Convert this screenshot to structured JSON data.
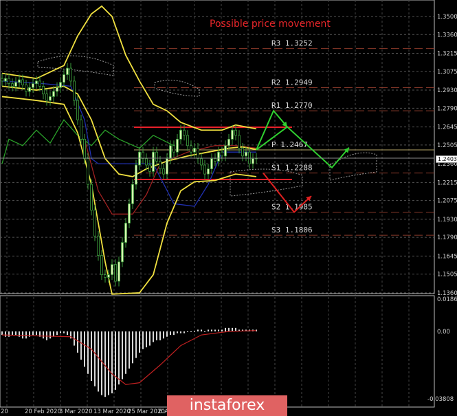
{
  "chart_data": {
    "type": "candlestick",
    "title": "Possible price movement",
    "symbol_last_price": "1.2403",
    "ylim": [
      1.136,
      1.365
    ],
    "y_ticks": [
      "1.3500",
      "1.3360",
      "1.3215",
      "1.3075",
      "1.2930",
      "1.2790",
      "1.2645",
      "1.2505",
      "1.2360",
      "1.2215",
      "1.2075",
      "1.1930",
      "1.1790",
      "1.1645",
      "1.1505",
      "1.1360"
    ],
    "y_tick_values": [
      1.35,
      1.336,
      1.3215,
      1.3075,
      1.293,
      1.279,
      1.2645,
      1.2505,
      1.236,
      1.2215,
      1.2075,
      1.193,
      1.179,
      1.1645,
      1.1505,
      1.136
    ],
    "x_ticks": [
      {
        "label": "20",
        "index": 0
      },
      {
        "label": "20 Feb 2020",
        "index": 7
      },
      {
        "label": "3 Mar 2020",
        "index": 17
      },
      {
        "label": "13 Mar 2020",
        "index": 27
      },
      {
        "label": "25 Mar 2020",
        "index": 37
      },
      {
        "label": "6 Apr",
        "index": 46
      }
    ],
    "closes": [
      1.3,
      1.302,
      1.298,
      1.296,
      1.299,
      1.301,
      1.297,
      1.292,
      1.295,
      1.298,
      1.3,
      1.296,
      1.29,
      1.285,
      1.288,
      1.292,
      1.295,
      1.299,
      1.305,
      1.31,
      1.3,
      1.285,
      1.27,
      1.255,
      1.24,
      1.22,
      1.2,
      1.18,
      1.165,
      1.15,
      1.148,
      1.15,
      1.158,
      1.145,
      1.16,
      1.175,
      1.19,
      1.205,
      1.22,
      1.235,
      1.245,
      1.24,
      1.235,
      1.23,
      1.245,
      1.238,
      1.232,
      1.228,
      1.24,
      1.25,
      1.245,
      1.255,
      1.262,
      1.258,
      1.25,
      1.245,
      1.248,
      1.24,
      1.235,
      1.228,
      1.232,
      1.24,
      1.238,
      1.245,
      1.242,
      1.25,
      1.255,
      1.262,
      1.258,
      1.248,
      1.242,
      1.245,
      1.236,
      1.24,
      1.2403
    ],
    "bollinger_upper": [
      [
        0,
        1.306
      ],
      [
        10,
        1.302
      ],
      [
        18,
        1.312
      ],
      [
        22,
        1.335
      ],
      [
        26,
        1.352
      ],
      [
        29,
        1.358
      ],
      [
        32,
        1.35
      ],
      [
        36,
        1.32
      ],
      [
        40,
        1.3
      ],
      [
        44,
        1.282
      ],
      [
        48,
        1.277
      ],
      [
        52,
        1.268
      ],
      [
        58,
        1.262
      ],
      [
        64,
        1.262
      ],
      [
        68,
        1.266
      ],
      [
        74,
        1.263
      ]
    ],
    "bollinger_middle": [
      [
        0,
        1.296
      ],
      [
        10,
        1.293
      ],
      [
        18,
        1.296
      ],
      [
        22,
        1.29
      ],
      [
        26,
        1.27
      ],
      [
        30,
        1.24
      ],
      [
        34,
        1.228
      ],
      [
        38,
        1.226
      ],
      [
        42,
        1.232
      ],
      [
        48,
        1.238
      ],
      [
        54,
        1.242
      ],
      [
        60,
        1.245
      ],
      [
        66,
        1.248
      ],
      [
        70,
        1.249
      ],
      [
        74,
        1.247
      ]
    ],
    "bollinger_lower": [
      [
        0,
        1.288
      ],
      [
        10,
        1.285
      ],
      [
        18,
        1.282
      ],
      [
        22,
        1.26
      ],
      [
        26,
        1.22
      ],
      [
        30,
        1.16
      ],
      [
        32,
        1.135
      ],
      [
        40,
        1.136
      ],
      [
        44,
        1.15
      ],
      [
        48,
        1.19
      ],
      [
        52,
        1.215
      ],
      [
        56,
        1.222
      ],
      [
        62,
        1.223
      ],
      [
        68,
        1.228
      ],
      [
        74,
        1.226
      ]
    ],
    "kijun_blue": [
      [
        0,
        1.3
      ],
      [
        12,
        1.298
      ],
      [
        20,
        1.296
      ],
      [
        24,
        1.27
      ],
      [
        26,
        1.24
      ],
      [
        28,
        1.236
      ],
      [
        40,
        1.236
      ],
      [
        44,
        1.236
      ],
      [
        50,
        1.205
      ],
      [
        56,
        1.203
      ],
      [
        60,
        1.22
      ],
      [
        64,
        1.245
      ],
      [
        74,
        1.245
      ]
    ],
    "tenkan_red": [
      [
        24,
        1.255
      ],
      [
        28,
        1.215
      ],
      [
        32,
        1.197
      ],
      [
        38,
        1.197
      ],
      [
        42,
        1.212
      ],
      [
        46,
        1.236
      ],
      [
        54,
        1.245
      ],
      [
        62,
        1.25
      ],
      [
        68,
        1.25
      ],
      [
        74,
        1.248
      ]
    ],
    "chikou_green": [
      [
        0,
        1.236
      ],
      [
        2,
        1.255
      ],
      [
        6,
        1.25
      ],
      [
        10,
        1.262
      ],
      [
        14,
        1.252
      ],
      [
        18,
        1.27
      ],
      [
        22,
        1.258
      ],
      [
        26,
        1.25
      ],
      [
        30,
        1.262
      ],
      [
        34,
        1.255
      ],
      [
        40,
        1.248
      ],
      [
        44,
        1.258
      ],
      [
        50,
        1.25
      ]
    ],
    "pivots": [
      {
        "label": "R3",
        "value": 1.3252,
        "text": "R3 1.3252"
      },
      {
        "label": "R2",
        "value": 1.2949,
        "text": "R2 1.2949"
      },
      {
        "label": "R1",
        "value": 1.277,
        "text": "R1 1.2770"
      },
      {
        "label": "P",
        "value": 1.2467,
        "text": "P 1.2467"
      },
      {
        "label": "S1",
        "value": 1.2288,
        "text": "S1 1.2288"
      },
      {
        "label": "S2",
        "value": 1.1985,
        "text": "S2 1.1985"
      },
      {
        "label": "S3",
        "value": 1.1806,
        "text": "S3 1.1806"
      }
    ],
    "range_lines": [
      1.2643,
      1.2238
    ],
    "macd": {
      "top_label": "0.0186",
      "zero_label": "0.00",
      "bottom_label": "-0.03808",
      "ylim": [
        -0.03808,
        0.0186
      ],
      "histogram": [
        -0.002,
        -0.003,
        -0.003,
        -0.002,
        -0.002,
        -0.003,
        -0.004,
        -0.004,
        -0.003,
        -0.002,
        -0.002,
        -0.003,
        -0.004,
        -0.005,
        -0.004,
        -0.003,
        -0.002,
        -0.001,
        -0.001,
        -0.002,
        -0.004,
        -0.008,
        -0.012,
        -0.016,
        -0.02,
        -0.024,
        -0.028,
        -0.031,
        -0.034,
        -0.036,
        -0.037,
        -0.036,
        -0.035,
        -0.033,
        -0.03,
        -0.027,
        -0.024,
        -0.021,
        -0.018,
        -0.015,
        -0.012,
        -0.01,
        -0.009,
        -0.008,
        -0.006,
        -0.005,
        -0.005,
        -0.004,
        -0.003,
        -0.002,
        -0.002,
        -0.001,
        -0.001,
        -0.001,
        0,
        0,
        0,
        0.001,
        0.001,
        0,
        0.001,
        0.001,
        0.001,
        0.001,
        0.001,
        0.002,
        0.002,
        0.002,
        0.002,
        0.001,
        0.001,
        0.001,
        0.001,
        0.001,
        0.001
      ],
      "signal": [
        [
          0,
          -0.002
        ],
        [
          20,
          -0.003
        ],
        [
          26,
          -0.01
        ],
        [
          32,
          -0.024
        ],
        [
          36,
          -0.03
        ],
        [
          40,
          -0.029
        ],
        [
          46,
          -0.019
        ],
        [
          52,
          -0.008
        ],
        [
          58,
          -0.002
        ],
        [
          66,
          0.0
        ],
        [
          74,
          0.0005
        ]
      ]
    },
    "scenario_green": [
      [
        1.2467,
        74
      ],
      [
        1.277,
        79
      ],
      [
        1.2645,
        83
      ]
    ],
    "scenario_green2": [
      [
        1.2467,
        74
      ],
      [
        1.2645,
        83
      ],
      [
        1.233,
        96
      ],
      [
        1.2485,
        101
      ]
    ],
    "scenario_red": [
      [
        1.2288,
        76
      ],
      [
        1.1985,
        85
      ],
      [
        1.211,
        90
      ]
    ]
  },
  "logo": "instaforex"
}
